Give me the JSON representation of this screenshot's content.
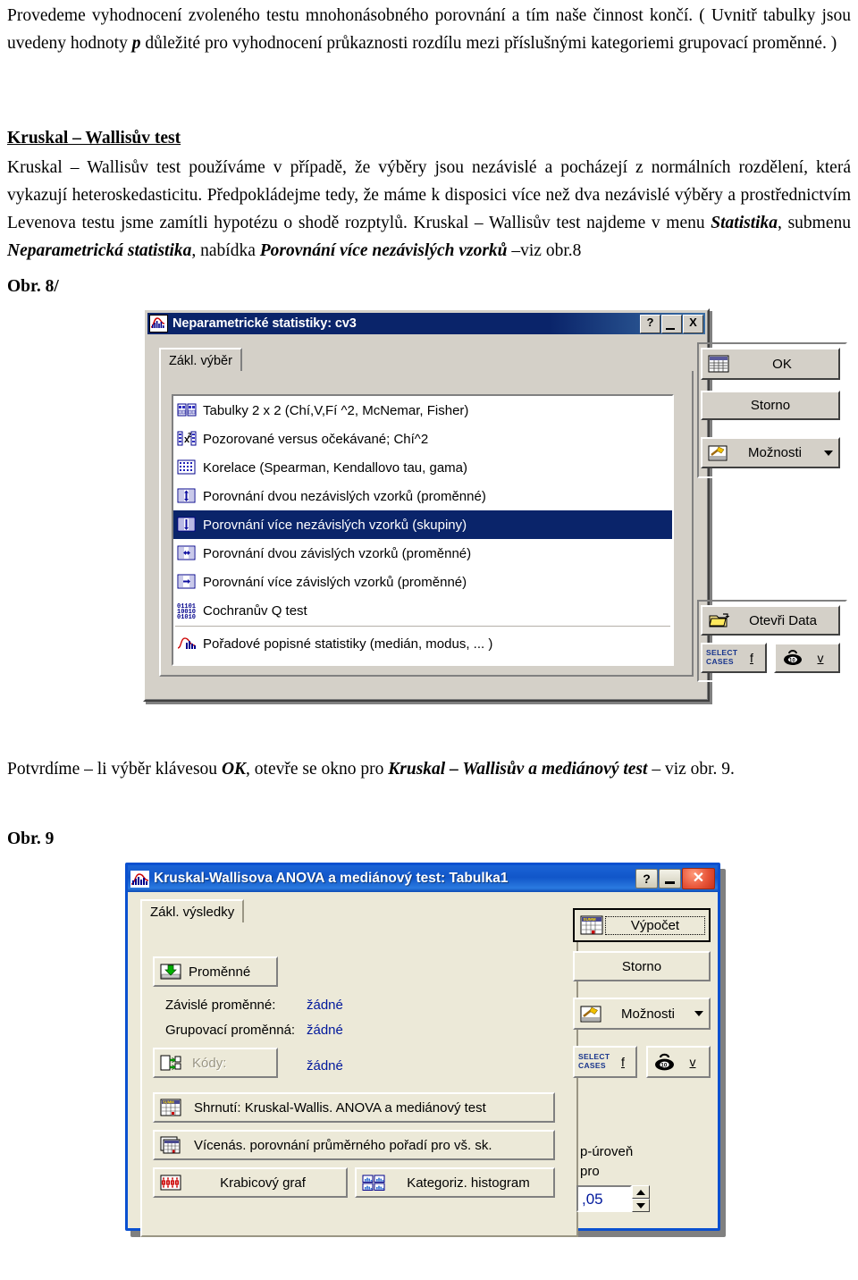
{
  "document": {
    "paragraph_1": "Provedeme vyhodnocení zvoleného testu mnohonásobného porovnání a tím naše činnost končí. ( Uvnitř tabulky jsou uvedeny hodnoty ",
    "paragraph_1_italic_1": "p",
    "paragraph_1_cont": " důležité pro vyhodnocení průkaznosti rozdílu mezi příslušnými kategoriemi grupovací proměnné. )",
    "section_heading": "Kruskal – Wallisův test",
    "paragraph_2_a": "Kruskal – Wallisův test používáme v případě, že výběry jsou nezávislé a pocházejí z normálních rozdělení, která vykazují heteroskedasticitu. Předpokládejme tedy, že máme k disposici více než dva nezávislé výběry a prostřednictvím Levenova testu jsme zamítli hypotézu o shodě rozptylů. Kruskal – Wallisův test najdeme v menu ",
    "paragraph_2_em1": "Statistika",
    "paragraph_2_b": ", submenu ",
    "paragraph_2_em2": "Neparametrická statistika",
    "paragraph_2_c": ", nabídka ",
    "paragraph_2_em3": "Porovnání více nezávislých vzorků",
    "paragraph_2_d": " –viz obr.8",
    "figure_8_label": "Obr. 8/",
    "paragraph_3_a": "Potvrdíme – li výběr klávesou ",
    "paragraph_3_em1": "OK",
    "paragraph_3_b": ", otevře se okno pro ",
    "paragraph_3_em2": "Kruskal – Wallisův a mediánový test",
    "paragraph_3_c": " – viz obr. 9.",
    "figure_9_label": "Obr. 9"
  },
  "dialog_nonparam": {
    "title": "Neparametrické statistiky: cv3",
    "app_icon": "statistics-chart-icon",
    "titlebar_buttons": [
      {
        "name": "help-button",
        "label": "?"
      },
      {
        "name": "minimize-button",
        "label": ""
      },
      {
        "name": "close-button",
        "label": "X"
      }
    ],
    "tab_label": "Zákl. výběr",
    "list_items": [
      {
        "label": "Tabulky 2 x 2 (Chí,V,Fí  ^2, McNemar, Fisher)",
        "icon": "two-by-two-table-icon",
        "selected": false
      },
      {
        "label": "Pozorované versus očekávané; Chí^2",
        "icon": "chi-square-icon",
        "selected": false
      },
      {
        "label": "Korelace (Spearman, Kendallovo tau, gama)",
        "icon": "correlation-grid-icon",
        "selected": false
      },
      {
        "label": "Porovnání dvou nezávislých vzorků (proměnné)",
        "icon": "two-independent-samples-icon",
        "selected": false
      },
      {
        "label": "Porovnání více nezávislých vzorků (skupiny)",
        "icon": "multi-independent-samples-icon",
        "selected": true
      },
      {
        "label": "Porovnání dvou závislých vzorků (proměnné)",
        "icon": "two-dependent-samples-icon",
        "selected": false
      },
      {
        "label": "Porovnání více závislých vzorků (proměnné)",
        "icon": "multi-dependent-samples-icon",
        "selected": false
      },
      {
        "label": "Cochranův Q test",
        "icon": "binary-digits-icon",
        "selected": false
      },
      {
        "label": "Pořadové popisné statistiky (medián, modus, ... )",
        "icon": "histogram-curve-icon",
        "selected": false
      }
    ],
    "buttons": {
      "ok": {
        "label": "OK",
        "icon": "spreadsheet-icon"
      },
      "cancel": {
        "label": "Storno",
        "icon": ""
      },
      "options": {
        "label": "Možnosti",
        "icon": "hammer-icon",
        "has_dropdown": true
      },
      "open_data": {
        "label": "Otevři Data",
        "icon": "open-folder-icon"
      },
      "select_cases": {
        "label_line1": "SELECT",
        "label_line2": "CASES",
        "accel": "f",
        "icon": "select-cases-icon"
      },
      "weight": {
        "label": "v",
        "icon": "weight-icon"
      }
    }
  },
  "dialog_kruskal": {
    "title": "Kruskal-Wallisova ANOVA a mediánový test: Tabulka1",
    "app_icon": "statistics-chart-icon",
    "titlebar_buttons": [
      {
        "name": "help-button",
        "label": "?"
      },
      {
        "name": "minimize-button",
        "label": ""
      },
      {
        "name": "close-button",
        "label": "✕"
      }
    ],
    "tab_label": "Zákl. výsledky",
    "left_buttons": {
      "variables": {
        "label": "Proměnné",
        "accel": "P",
        "icon": "variables-arrow-icon"
      },
      "codes": {
        "label": "Kódy:",
        "accel": "K",
        "icon": "codes-arrow-icon",
        "disabled": true
      },
      "summary": {
        "label": "Shrnutí: Kruskal-Wallis. ANOVA  a mediánový test",
        "accel": "h",
        "icon": "summary-table-icon"
      },
      "multiple_comparison": {
        "label": "Vícenás. porovnání průměrného pořadí pro vš. sk.",
        "accel": "V",
        "icon": "multi-table-icon"
      },
      "boxplot": {
        "label": "Krabicový graf",
        "accel": "r",
        "icon": "boxplot-icon"
      },
      "cat_histogram": {
        "label": "Kategoriz. histogram",
        "accel": "h",
        "icon": "cat-histogram-icon"
      }
    },
    "fields": [
      {
        "label": "Závislé proměnné:",
        "value": "žádné"
      },
      {
        "label": "Grupovací proměnná:",
        "value": "žádné"
      },
      {
        "label": "",
        "value": "žádné"
      }
    ],
    "right_buttons": {
      "compute": {
        "label": "Výpočet",
        "icon": "summary-table-icon",
        "is_default": true
      },
      "cancel": {
        "label": "Storno",
        "icon": ""
      },
      "options": {
        "label": "Možnosti",
        "icon": "hammer-icon",
        "has_dropdown": true
      },
      "select_cases": {
        "label_line1": "SELECT",
        "label_line2": "CASES",
        "accel": "f",
        "icon": "select-cases-icon"
      },
      "weight": {
        "label": "v",
        "icon": "weight-icon"
      }
    },
    "p_level": {
      "label_line1": "p-úroveň",
      "label_line2": "pro",
      "value": ",05"
    }
  },
  "colors": {
    "win95_face": "#d4d0c8",
    "win95_titlebar": "#0a246a",
    "xp_face": "#ece9d8",
    "xp_titlebar": "#1156c9",
    "xp_border": "#0a50d0",
    "selection": "#0a246a",
    "field_value_blue": "#00189c",
    "close_red": "#e8563a"
  }
}
